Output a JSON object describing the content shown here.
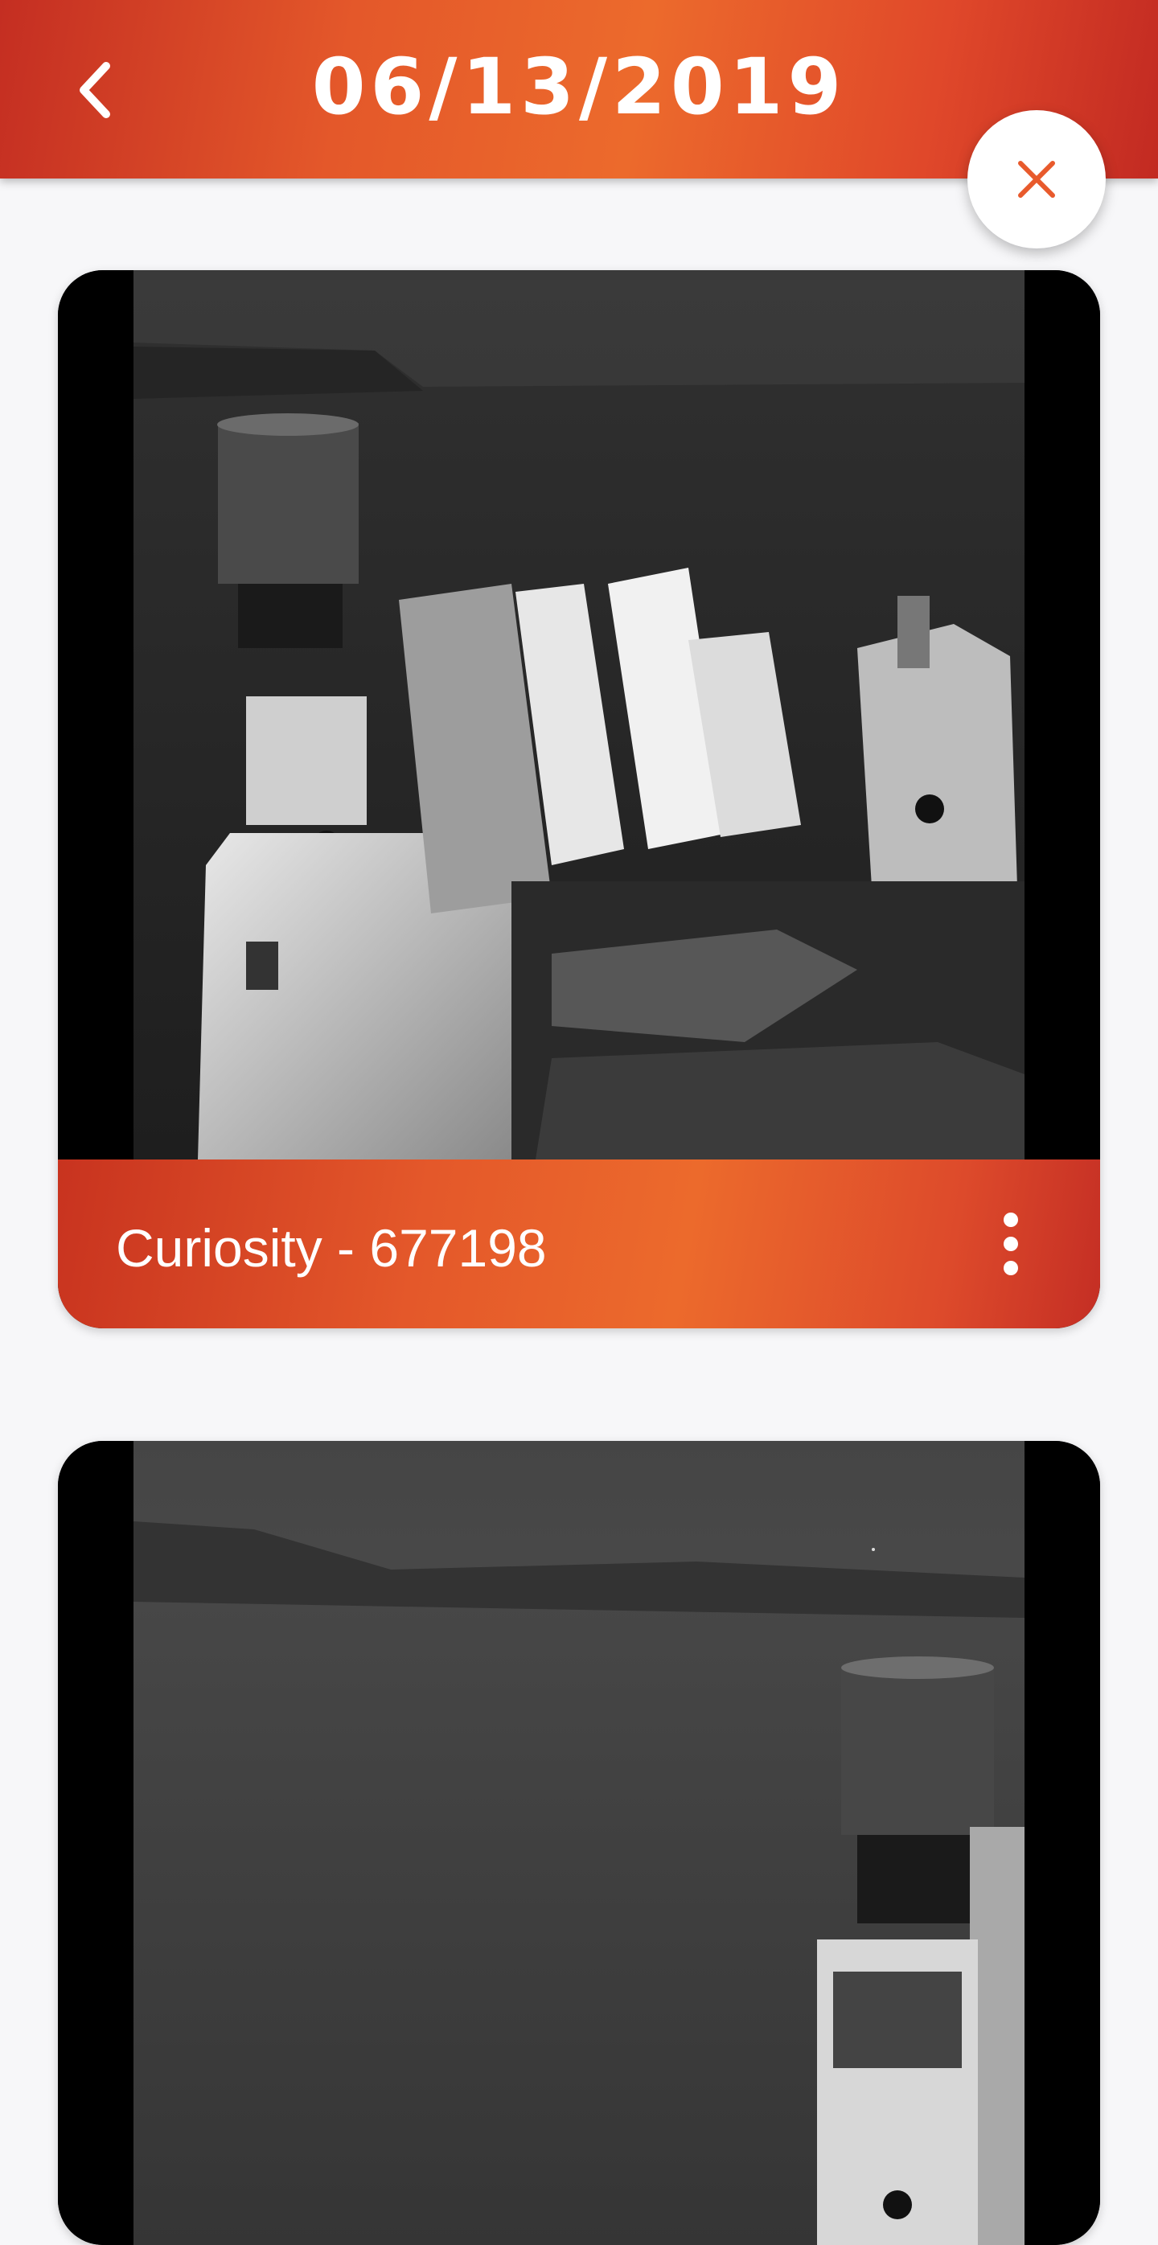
{
  "header": {
    "title": "06/13/2019",
    "back_icon": "chevron-left-icon",
    "close_icon": "close-icon",
    "accent_color": "#e85f2c",
    "close_icon_color": "#e85a2c"
  },
  "photos": [
    {
      "title": "Curiosity - 677198",
      "menu_icon": "more-vert-icon"
    },
    {
      "title": "",
      "menu_icon": "more-vert-icon"
    }
  ]
}
